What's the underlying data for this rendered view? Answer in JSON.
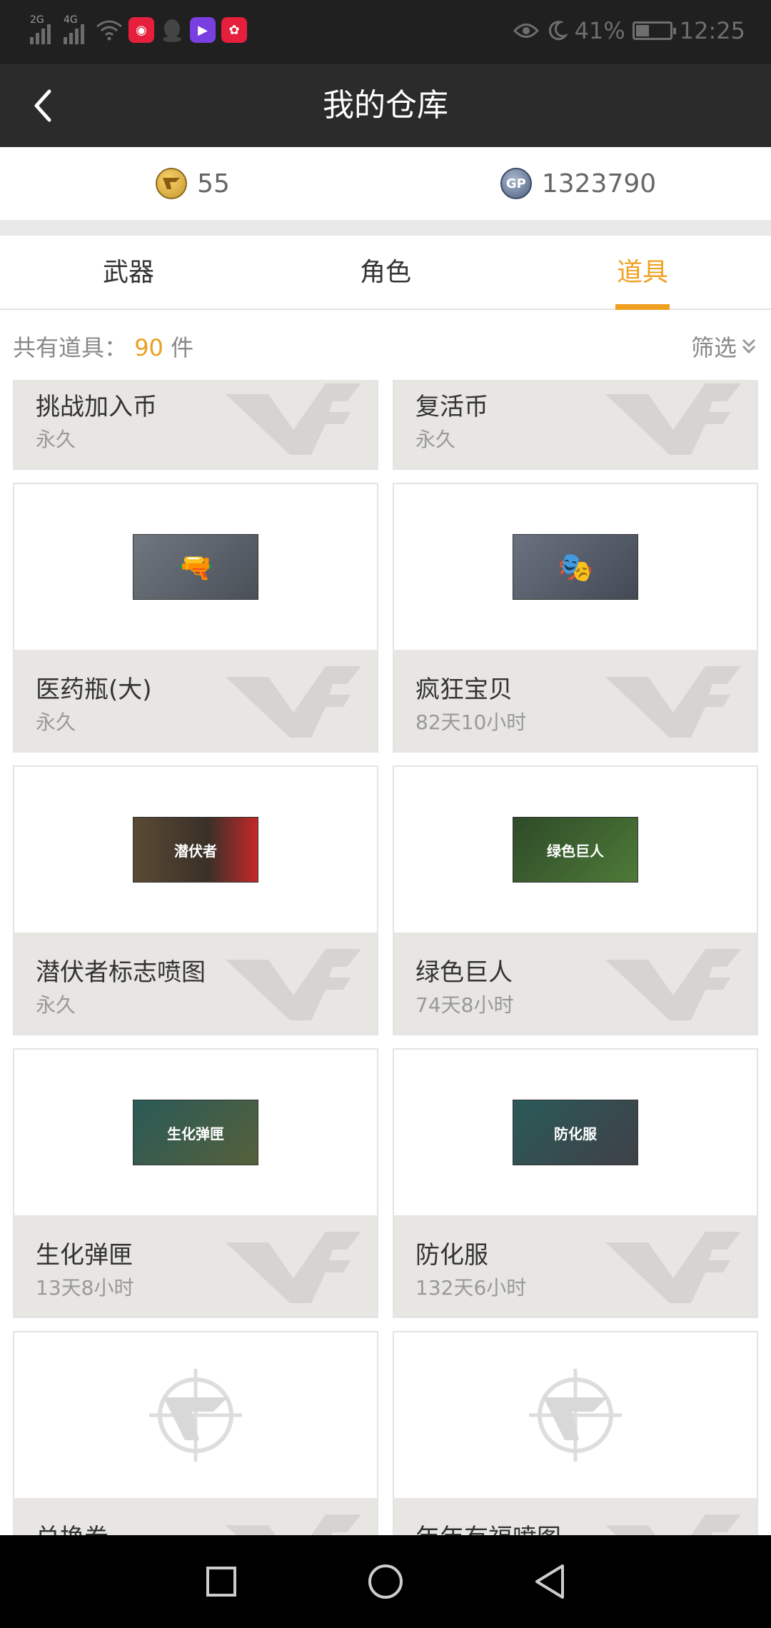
{
  "status_bar": {
    "network1": "2G",
    "network2": "4G",
    "battery": "41%",
    "time": "12:25"
  },
  "header": {
    "title": "我的仓库"
  },
  "currency": {
    "cf_points": "55",
    "gp": "1323790",
    "gp_badge": "GP"
  },
  "tabs": [
    {
      "label": "武器",
      "active": false
    },
    {
      "label": "角色",
      "active": false
    },
    {
      "label": "道具",
      "active": true
    }
  ],
  "summary": {
    "prefix": "共有道具：",
    "count": "90",
    "unit": "件",
    "filter_label": "筛选"
  },
  "items": [
    {
      "name": "挑战加入币",
      "duration": "永久"
    },
    {
      "name": "复活币",
      "duration": "永久"
    },
    {
      "name": "医药瓶(大)",
      "duration": "永久"
    },
    {
      "name": "疯狂宝贝",
      "duration": "82天10小时"
    },
    {
      "name": "潜伏者标志喷图",
      "duration": "永久",
      "image_text": "潜伏者"
    },
    {
      "name": "绿色巨人",
      "duration": "74天8小时",
      "image_text": "绿色巨人"
    },
    {
      "name": "生化弹匣",
      "duration": "13天8小时",
      "image_text": "生化弹匣"
    },
    {
      "name": "防化服",
      "duration": "132天6小时",
      "image_text": "防化服"
    },
    {
      "name": "兑换券",
      "duration": ""
    },
    {
      "name": "年年有福喷图",
      "duration": ""
    }
  ],
  "colors": {
    "accent": "#f0a020",
    "header_bg": "#2b2b2b",
    "card_info_bg": "#e8e6e3"
  }
}
